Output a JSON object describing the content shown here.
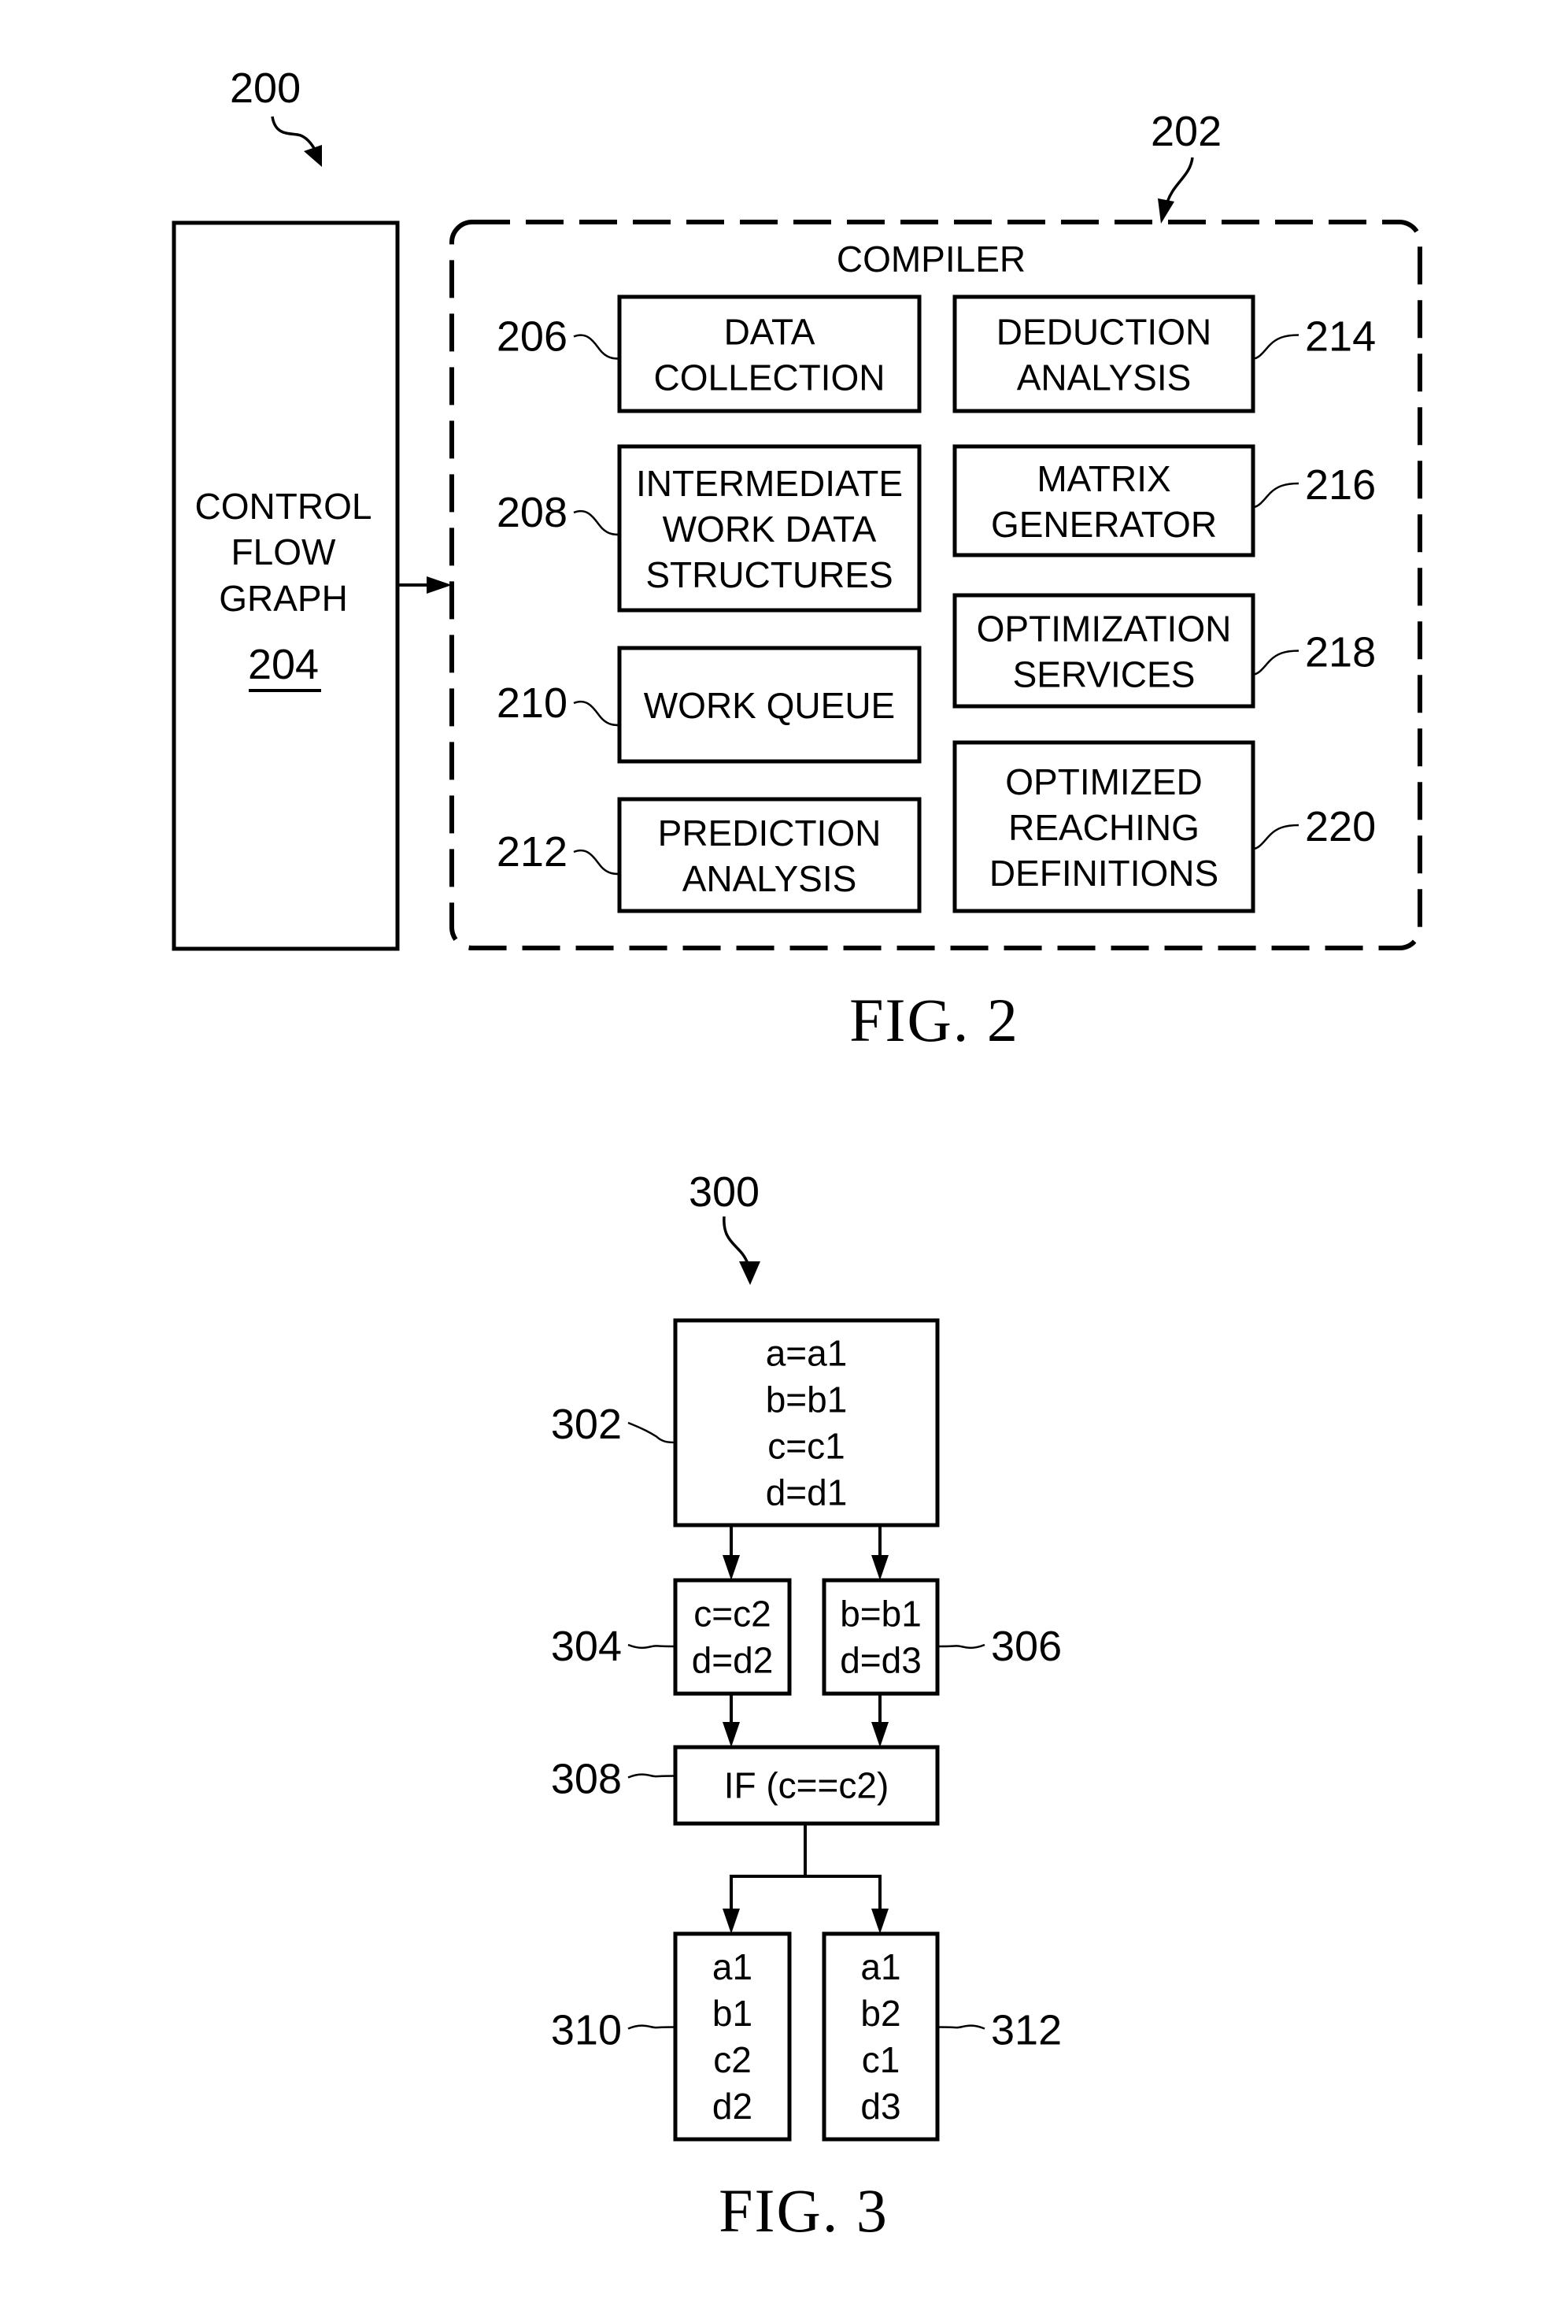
{
  "fig2": {
    "caption": "FIG. 2",
    "ref_main": "200",
    "control_flow_graph": {
      "lines": [
        "CONTROL",
        "FLOW",
        "GRAPH"
      ],
      "ref": "204"
    },
    "compiler": {
      "title": "COMPILER",
      "ref": "202",
      "components": [
        {
          "id": "data-collection",
          "ref": "206",
          "lines": [
            "DATA",
            "COLLECTION"
          ]
        },
        {
          "id": "intermediate-work-data-structures",
          "ref": "208",
          "lines": [
            "INTERMEDIATE",
            "WORK DATA",
            "STRUCTURES"
          ]
        },
        {
          "id": "work-queue",
          "ref": "210",
          "lines": [
            "WORK QUEUE"
          ]
        },
        {
          "id": "prediction-analysis",
          "ref": "212",
          "lines": [
            "PREDICTION",
            "ANALYSIS"
          ]
        },
        {
          "id": "deduction-analysis",
          "ref": "214",
          "lines": [
            "DEDUCTION",
            "ANALYSIS"
          ]
        },
        {
          "id": "matrix-generator",
          "ref": "216",
          "lines": [
            "MATRIX",
            "GENERATOR"
          ]
        },
        {
          "id": "optimization-services",
          "ref": "218",
          "lines": [
            "OPTIMIZATION",
            "SERVICES"
          ]
        },
        {
          "id": "optimized-reaching-definitions",
          "ref": "220",
          "lines": [
            "OPTIMIZED",
            "REACHING",
            "DEFINITIONS"
          ]
        }
      ]
    }
  },
  "fig3": {
    "caption": "FIG. 3",
    "ref_main": "300",
    "blocks": [
      {
        "id": "block-302",
        "ref": "302",
        "lines": [
          "a=a1",
          "b=b1",
          "c=c1",
          "d=d1"
        ]
      },
      {
        "id": "block-304",
        "ref": "304",
        "lines": [
          "c=c2",
          "d=d2"
        ]
      },
      {
        "id": "block-306",
        "ref": "306",
        "lines": [
          "b=b1",
          "d=d3"
        ]
      },
      {
        "id": "block-308",
        "ref": "308",
        "lines": [
          "IF (c==c2)"
        ]
      },
      {
        "id": "block-310",
        "ref": "310",
        "lines": [
          "a1",
          "b1",
          "c2",
          "d2"
        ]
      },
      {
        "id": "block-312",
        "ref": "312",
        "lines": [
          "a1",
          "b2",
          "c1",
          "d3"
        ]
      }
    ]
  }
}
